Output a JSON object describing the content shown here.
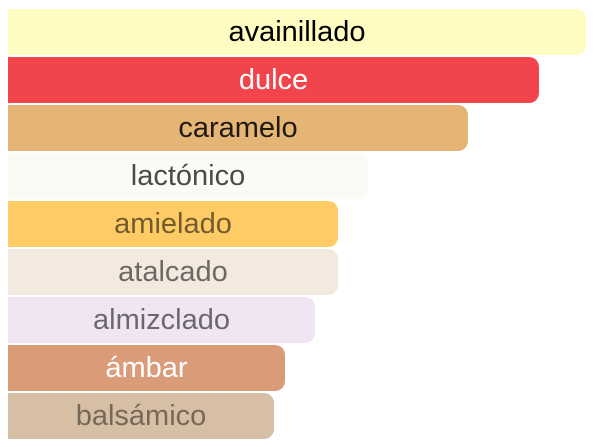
{
  "accords": [
    {
      "label": "avainillado",
      "strength": 98,
      "bg": "#fffcc1",
      "fg": "#000000",
      "opacity": 1
    },
    {
      "label": "dulce",
      "strength": 90,
      "bg": "#f2454b",
      "fg": "#ffffff",
      "opacity": 1
    },
    {
      "label": "caramelo",
      "strength": 78,
      "bg": "#e5b575",
      "fg": "#000000",
      "opacity": 0.85
    },
    {
      "label": "lactónico",
      "strength": 61,
      "bg": "#fbfaf4",
      "fg": "#000000",
      "opacity": 0.7
    },
    {
      "label": "amielado",
      "strength": 56,
      "bg": "#fecb65",
      "fg": "#000000",
      "opacity": 0.55
    },
    {
      "label": "atalcado",
      "strength": 56,
      "bg": "#f3e9df",
      "fg": "#000000",
      "opacity": 0.55
    },
    {
      "label": "almizclado",
      "strength": 52,
      "bg": "#f0e6f3",
      "fg": "#000000",
      "opacity": 0.55
    },
    {
      "label": "ámbar",
      "strength": 47,
      "bg": "#da9b79",
      "fg": "#ffffff",
      "opacity": 1
    },
    {
      "label": "balsámico",
      "strength": 45,
      "bg": "#d6bfa4",
      "fg": "#000000",
      "opacity": 0.45
    }
  ]
}
